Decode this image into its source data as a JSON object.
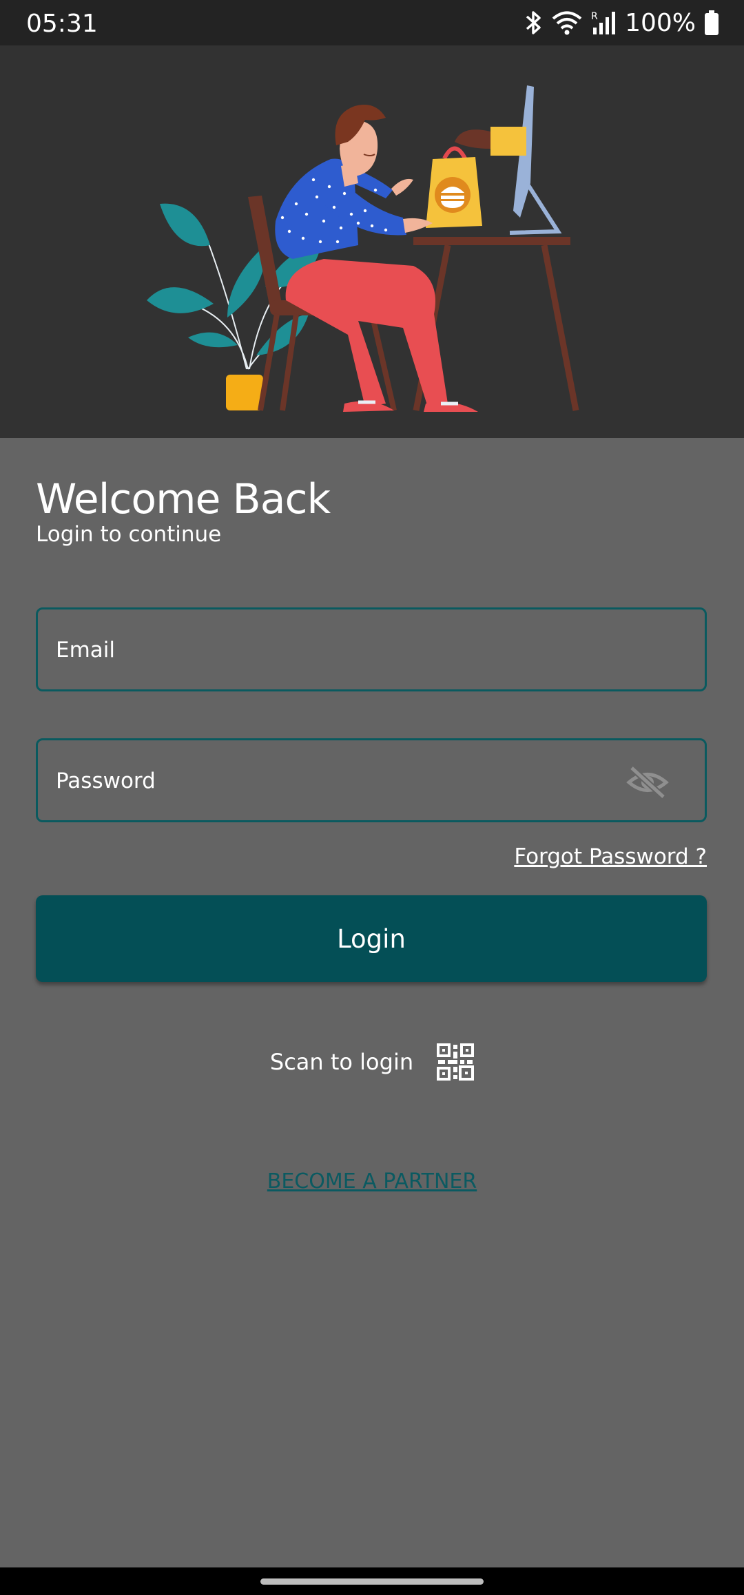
{
  "status_bar": {
    "time": "05:31",
    "battery": "100%",
    "icons": [
      "bluetooth-icon",
      "wifi-icon",
      "signal-icon",
      "battery-icon"
    ]
  },
  "hero": {
    "illustration": "person-ordering-food-online"
  },
  "login": {
    "title": "Welcome Back",
    "subtitle": "Login to continue",
    "email_placeholder": "Email",
    "password_placeholder": "Password",
    "forgot_label": "Forgot Password ?",
    "login_label": "Login",
    "scan_label": "Scan to login",
    "partner_label": "BECOME A PARTNER"
  },
  "colors": {
    "background": "#646464",
    "hero_background": "#323232",
    "primary": "#044f56",
    "field_border": "#0a5a5f",
    "link_accent": "#0b5a61"
  }
}
